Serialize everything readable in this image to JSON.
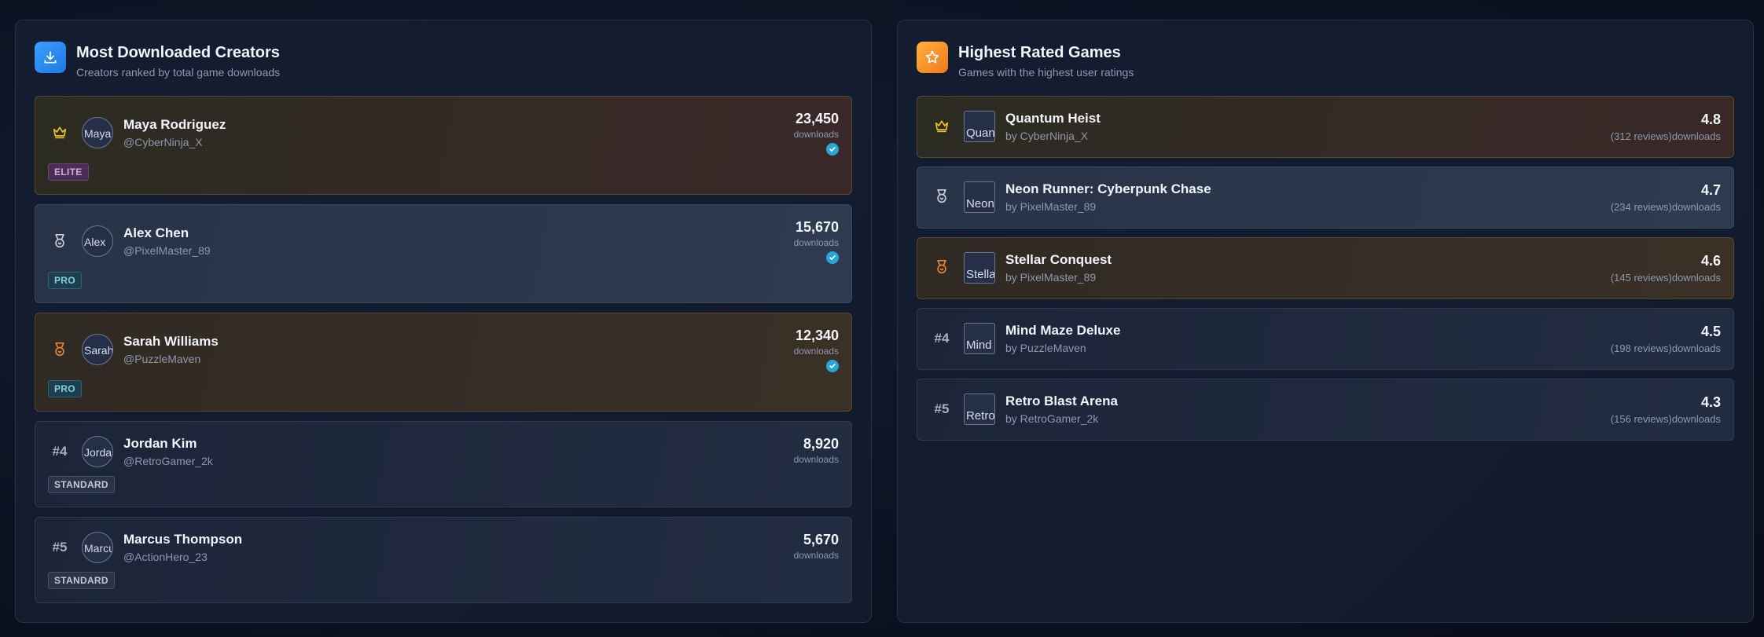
{
  "creators_panel": {
    "title": "Most Downloaded Creators",
    "subtitle": "Creators ranked by total game downloads",
    "icon": "download-icon",
    "accent": "#2a8cf0",
    "items": [
      {
        "rank": "",
        "rank_icon": "crown-icon",
        "avatar_alt": "Maya",
        "name": "Maya Rodriguez",
        "handle": "@CyberNinja_X",
        "downloads": "23,450",
        "downloads_label": "downloads",
        "verified": true,
        "tier": "ELITE"
      },
      {
        "rank": "",
        "rank_icon": "medal-icon",
        "avatar_alt": "Alex",
        "name": "Alex Chen",
        "handle": "@PixelMaster_89",
        "downloads": "15,670",
        "downloads_label": "downloads",
        "verified": true,
        "tier": "PRO"
      },
      {
        "rank": "",
        "rank_icon": "medal-icon",
        "avatar_alt": "Sarah",
        "name": "Sarah Williams",
        "handle": "@PuzzleMaven",
        "downloads": "12,340",
        "downloads_label": "downloads",
        "verified": true,
        "tier": "PRO"
      },
      {
        "rank": "#4",
        "avatar_alt": "Jordan",
        "name": "Jordan Kim",
        "handle": "@RetroGamer_2k",
        "downloads": "8,920",
        "downloads_label": "downloads",
        "verified": false,
        "tier": "STANDARD"
      },
      {
        "rank": "#5",
        "avatar_alt": "Marcus",
        "name": "Marcus Thompson",
        "handle": "@ActionHero_23",
        "downloads": "5,670",
        "downloads_label": "downloads",
        "verified": false,
        "tier": "STANDARD"
      }
    ]
  },
  "games_panel": {
    "title": "Highest Rated Games",
    "subtitle": "Games with the highest user ratings",
    "icon": "star-icon",
    "accent": "#f59a2a",
    "items": [
      {
        "rank": "",
        "rank_icon": "crown-icon",
        "thumb_alt": "Quantum",
        "name": "Quantum Heist",
        "by": "by CyberNinja_X",
        "rating": "4.8",
        "reviews": "(312 reviews)downloads"
      },
      {
        "rank": "",
        "rank_icon": "medal-icon",
        "thumb_alt": "Neon",
        "name": "Neon Runner: Cyberpunk Chase",
        "by": "by PixelMaster_89",
        "rating": "4.7",
        "reviews": "(234 reviews)downloads"
      },
      {
        "rank": "",
        "rank_icon": "medal-icon",
        "thumb_alt": "Stellar",
        "name": "Stellar Conquest",
        "by": "by PixelMaster_89",
        "rating": "4.6",
        "reviews": "(145 reviews)downloads"
      },
      {
        "rank": "#4",
        "thumb_alt": "Mind",
        "name": "Mind Maze Deluxe",
        "by": "by PuzzleMaven",
        "rating": "4.5",
        "reviews": "(198 reviews)downloads"
      },
      {
        "rank": "#5",
        "thumb_alt": "Retro",
        "name": "Retro Blast Arena",
        "by": "by RetroGamer_2k",
        "rating": "4.3",
        "reviews": "(156 reviews)downloads"
      }
    ]
  }
}
